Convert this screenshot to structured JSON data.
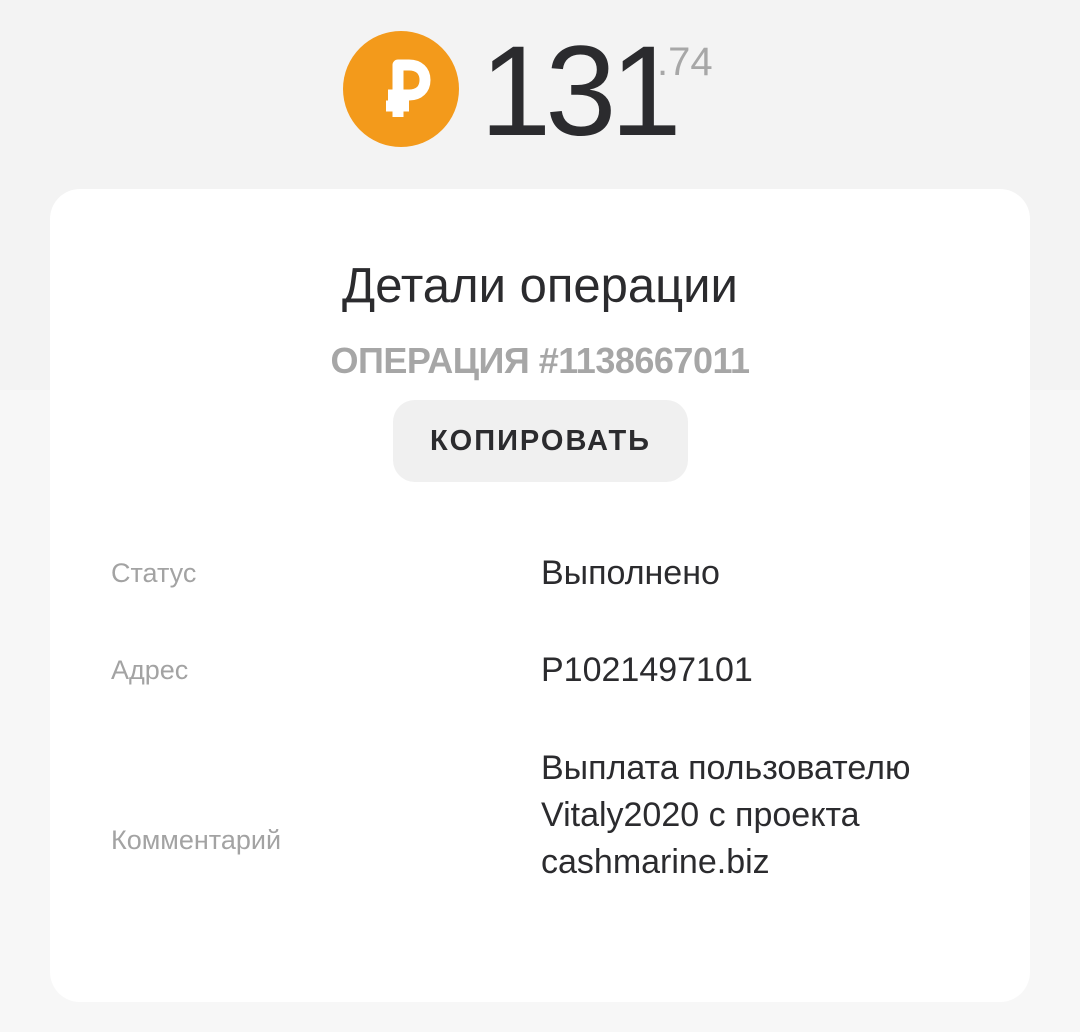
{
  "balance": {
    "currency_icon": "ruble-coin-icon",
    "integer": "131",
    "fraction": ".74"
  },
  "details": {
    "title": "Детали операции",
    "operation_number": "ОПЕРАЦИЯ #1138667011",
    "copy_label": "КОПИРОВАТЬ",
    "rows": [
      {
        "label": "Статус",
        "value": "Выполнено"
      },
      {
        "label": "Адрес",
        "value": "P1021497101"
      },
      {
        "label": "Комментарий",
        "value": "Выплата пользователю Vitaly2020 с проекта cashmarine.biz"
      }
    ]
  },
  "colors": {
    "coin": "#f39a1b",
    "text": "#2b2b2e",
    "muted": "#a6a6a6",
    "button_bg": "#f0f0f0",
    "page_top": "#f3f3f3",
    "page_bottom": "#f7f7f7",
    "card": "#ffffff"
  }
}
